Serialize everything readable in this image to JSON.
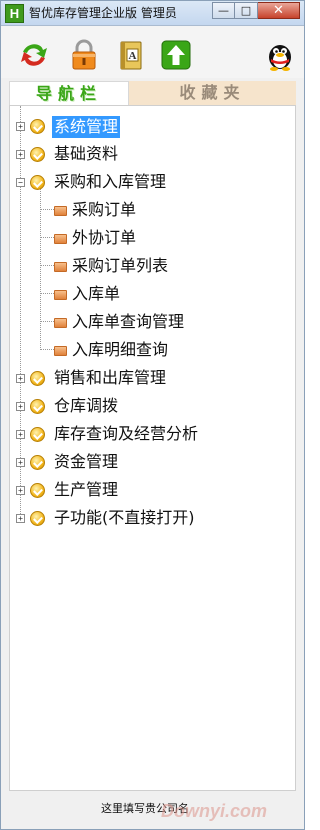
{
  "window": {
    "app_icon_letter": "H",
    "title": "智优库存管理企业版 管理员",
    "controls": {
      "minimize": "—",
      "maximize": "□",
      "close": "✕"
    }
  },
  "toolbar": {
    "buttons": [
      {
        "icon": "switch-arrows-icon",
        "color": "#d42b1f"
      },
      {
        "icon": "lock-icon",
        "color": "#f08a1c"
      },
      {
        "icon": "address-book-icon",
        "color": "#e8c65a"
      },
      {
        "icon": "upload-arrow-icon",
        "color": "#3aa617"
      },
      {
        "icon": "qq-penguin-icon",
        "color": "#111111"
      }
    ]
  },
  "tabs": {
    "navigation": "导航栏",
    "favorites": "收藏夹"
  },
  "tree": {
    "nodes": [
      {
        "label": "系统管理",
        "expanded": false,
        "selected": true
      },
      {
        "label": "基础资料",
        "expanded": false
      },
      {
        "label": "采购和入库管理",
        "expanded": true,
        "children": [
          "采购订单",
          "外协订单",
          "采购订单列表",
          "入库单",
          "入库单查询管理",
          "入库明细查询"
        ]
      },
      {
        "label": "销售和出库管理",
        "expanded": false
      },
      {
        "label": "仓库调拨",
        "expanded": false
      },
      {
        "label": "库存查询及经营分析",
        "expanded": false
      },
      {
        "label": "资金管理",
        "expanded": false
      },
      {
        "label": "生产管理",
        "expanded": false
      },
      {
        "label": "子功能(不直接打开)",
        "expanded": false
      }
    ],
    "expander_collapsed": "+",
    "expander_expanded": "−"
  },
  "statusbar": {
    "text": "这里填写贵公司名",
    "watermark": "Downyi.com"
  },
  "colors": {
    "selection": "#3399ff",
    "tab_active_text": "#3aa617",
    "tab_inactive_bg": "#f6e4cc"
  }
}
